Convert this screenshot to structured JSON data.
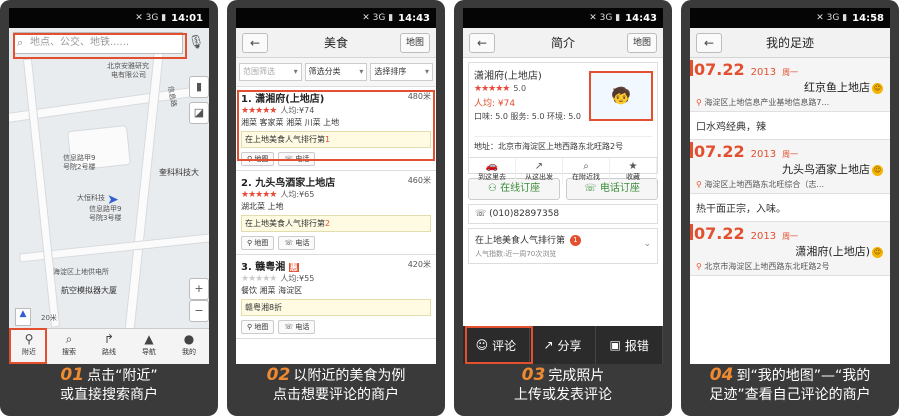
{
  "status": {
    "signal": "✕ 3G ▮",
    "times": [
      "14:01",
      "14:43",
      "14:43",
      "14:58"
    ]
  },
  "panel1": {
    "search_placeholder": "地点、公交、地铁......",
    "map_labels": [
      "北京安雅研究",
      "电有限公司",
      "信息路",
      "信息路甲9",
      "号院2号楼",
      "奎科科技大",
      "大恒科技",
      "信息路甲9",
      "号院3号楼",
      "海淀区上地供电所",
      "航空模拟器大厦"
    ],
    "scale": "20米",
    "compass": "指南",
    "nav": [
      "附近",
      "搜索",
      "路线",
      "导航",
      "我的"
    ],
    "caption_num": "01",
    "caption": [
      "点击“附近”",
      "或直接搜索商户"
    ]
  },
  "panel2": {
    "title": "美食",
    "map_button": "地图",
    "filters": [
      "范围筛选",
      "筛选分类",
      "选择排序"
    ],
    "restaurants": [
      {
        "name": "1. 潇湘府(上地店)",
        "distance": "480米",
        "stars": "★★★★★",
        "price": "人均:¥74",
        "tags": "湘菜 客家菜 湘菜 川菜 上地",
        "rank_text": "在上地美食人气排行第",
        "rank_num": "1"
      },
      {
        "name": "2. 九头鸟酒家上地店",
        "distance": "460米",
        "stars": "★★★★★",
        "price": "人均:¥65",
        "tags": "湖北菜 上地",
        "rank_text": "在上地美食人气排行第",
        "rank_num": "2"
      },
      {
        "name": "3. 赣粤湘",
        "hui": "惠",
        "distance": "420米",
        "stars": "★★★★★",
        "price": "人均:¥55",
        "tags": "餐饮 湘菜 海淀区",
        "rank_text": "赣粤湘8折",
        "rank_num": ""
      }
    ],
    "map_act": "地图",
    "phone_act": "电话",
    "caption_num": "02",
    "caption": [
      "以附近的美食为例",
      "点击想要评论的商户"
    ]
  },
  "panel3": {
    "title": "简介",
    "map_button": "地图",
    "name": "潇湘府(上地店)",
    "rating": "5.0",
    "price": "人均: ¥74",
    "scores": "口味: 5.0  服务: 5.0  环境: 5.0",
    "address": "地址：北京市海淀区上地西路东北旺路2号",
    "actions": [
      "到这里去",
      "从这出发",
      "在附近找",
      "收藏"
    ],
    "book_online": "在线订座",
    "book_phone": "电话订座",
    "phone": "(010)82897358",
    "rank_text": "在上地美食人气排行第",
    "rank_num": "1",
    "rank_sub": "人气指数:近一周70次浏览",
    "bottom": [
      "评论",
      "分享",
      "报错"
    ],
    "caption_num": "03",
    "caption": [
      "完成照片",
      "上传或发表评论"
    ]
  },
  "panel4": {
    "title": "我的足迹",
    "entries": [
      {
        "date": "07.22",
        "year": "2013",
        "weekday": "周一",
        "name": "红京鱼上地店",
        "addr": "海淀区上地信息产业基地信息路7...",
        "comment": "口水鸡经典，辣"
      },
      {
        "date": "07.22",
        "year": "2013",
        "weekday": "周一",
        "name": "九头鸟酒家上地店",
        "addr": "海淀区上地西路东北旺综合（志...",
        "comment": "热干面正宗，入味。"
      },
      {
        "date": "07.22",
        "year": "2013",
        "weekday": "周一",
        "name": "潇湘府(上地店)",
        "addr": "北京市海淀区上地西路东北旺路2号",
        "comment": ""
      }
    ],
    "caption_num": "04",
    "caption": [
      "到“我的地图”—“我的",
      "足迹”查看自己评论的商户"
    ]
  }
}
